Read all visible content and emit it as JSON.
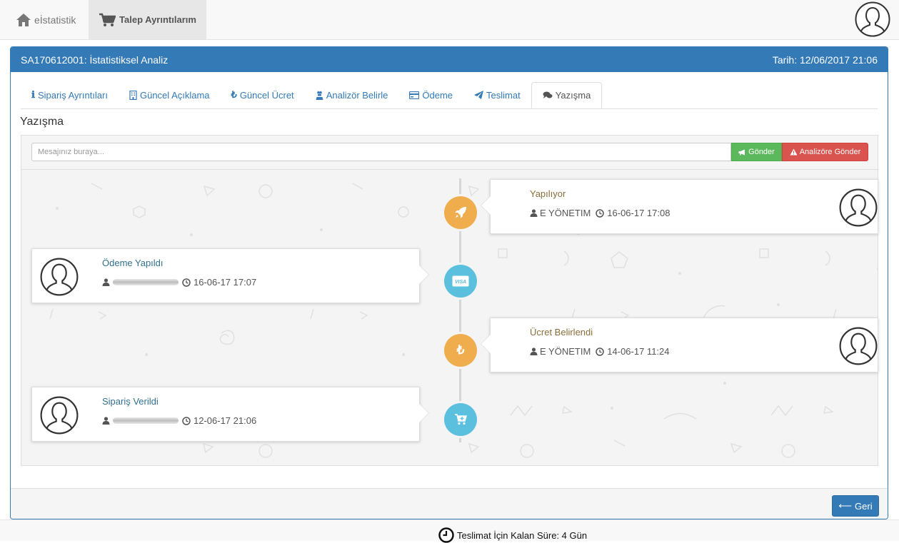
{
  "nav": {
    "brand_label": "eİstatistik",
    "active_item_label": "Talep Ayrıntılarım"
  },
  "panel": {
    "title": "SA170612001: İstatistiksel Analiz",
    "date_label": "Tarih: 12/06/2017 21:06"
  },
  "tabs": [
    {
      "icon": "info-icon",
      "label": "Sipariş Ayrıntıları"
    },
    {
      "icon": "building-icon",
      "label": "Güncel Açıklama"
    },
    {
      "icon": "lira-icon",
      "label": "Güncel Ücret"
    },
    {
      "icon": "user-secret-icon",
      "label": "Analizör Belirle"
    },
    {
      "icon": "credit-card-icon",
      "label": "Ödeme"
    },
    {
      "icon": "paper-plane-icon",
      "label": "Teslimat"
    },
    {
      "icon": "comments-icon",
      "label": "Yazışma",
      "active": true
    }
  ],
  "section_title": "Yazışma",
  "message": {
    "placeholder": "Mesajınız buraya...",
    "send_label": "Gönder",
    "send_analyst_label": "Analizöre Gönder"
  },
  "timeline": [
    {
      "side": "right",
      "title": "Yapılıyor",
      "author": "E YÖNETIM",
      "time": "16-06-17 17:08",
      "badge_icon": "rocket-icon",
      "badge_color": "#f0ad4e",
      "title_color": "#8a6d3b"
    },
    {
      "side": "left",
      "title": "Ödeme Yapıldı",
      "author": "",
      "time": "16-06-17 17:07",
      "badge_icon": "visa-icon",
      "badge_color": "#5bc0de",
      "title_color": "#31708f"
    },
    {
      "side": "right",
      "title": "Ücret Belirlendi",
      "author": "E YÖNETIM",
      "time": "14-06-17 11:24",
      "badge_icon": "lira-icon",
      "badge_color": "#f0ad4e",
      "title_color": "#8a6d3b"
    },
    {
      "side": "left",
      "title": "Sipariş Verildi",
      "author": "",
      "time": "12-06-17 21:06",
      "badge_icon": "cart-icon",
      "badge_color": "#5bc0de",
      "title_color": "#31708f"
    }
  ],
  "back_label": "Geri",
  "footer": {
    "deadline": "Teslimat İçin Kalan Süre: 4 Gün"
  }
}
